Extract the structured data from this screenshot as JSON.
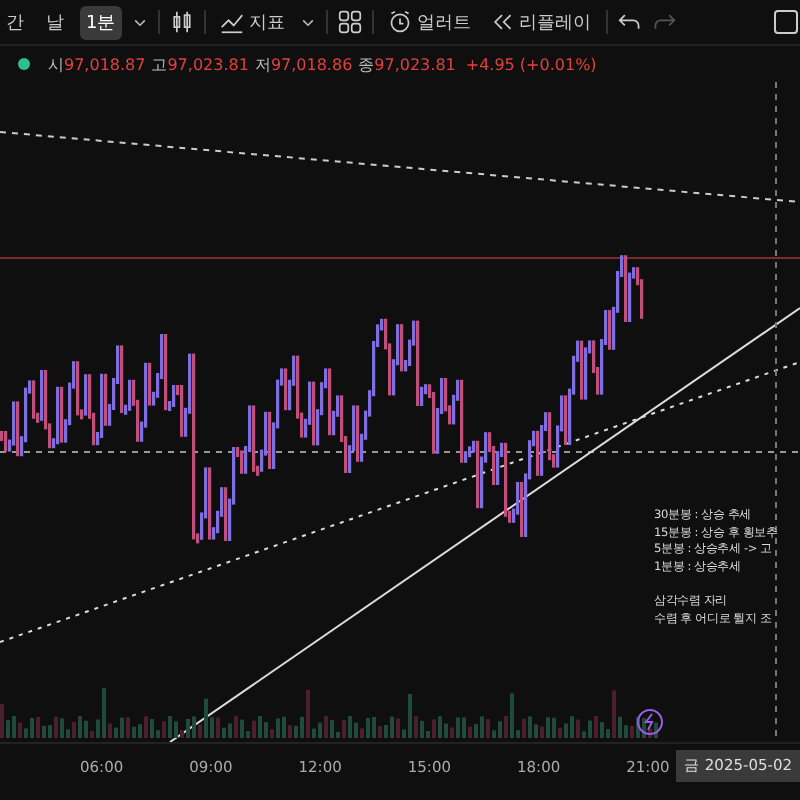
{
  "toolbar": {
    "items": [
      {
        "kind": "text",
        "label": "간",
        "selected": false
      },
      {
        "kind": "text",
        "label": "날",
        "selected": false
      },
      {
        "kind": "text",
        "label": "1분",
        "selected": true
      },
      {
        "kind": "caret"
      },
      {
        "kind": "candles"
      },
      {
        "kind": "indicator",
        "label": "지표"
      },
      {
        "kind": "caret"
      },
      {
        "kind": "grid"
      },
      {
        "kind": "alert",
        "label": "얼러트"
      },
      {
        "kind": "replay",
        "label": "리플레이"
      },
      {
        "kind": "undo"
      },
      {
        "kind": "redo"
      }
    ]
  },
  "ohlc": {
    "fields": [
      {
        "label": "시",
        "value": "97,018.87"
      },
      {
        "label": "고",
        "value": "97,023.81"
      },
      {
        "label": "저",
        "value": "97,018.86"
      },
      {
        "label": "종",
        "value": "97,023.81"
      }
    ],
    "change": "+4.95 (+0.01%)"
  },
  "chart": {
    "note": [
      "30분봉 : 상승 추세",
      "15분봉 : 상승 후 횡보추",
      "5분봉 : 상승추세 -> 고",
      "1분봉 : 상승추세"
    ],
    "note2": [
      "삼각수렴 자리",
      "수렴 후 어디로 튈지 조"
    ]
  },
  "time_axis": {
    "labels": [
      "06:00",
      "09:00",
      "12:00",
      "15:00",
      "18:00",
      "21:00"
    ],
    "date": "금 2025-05-02"
  }
}
